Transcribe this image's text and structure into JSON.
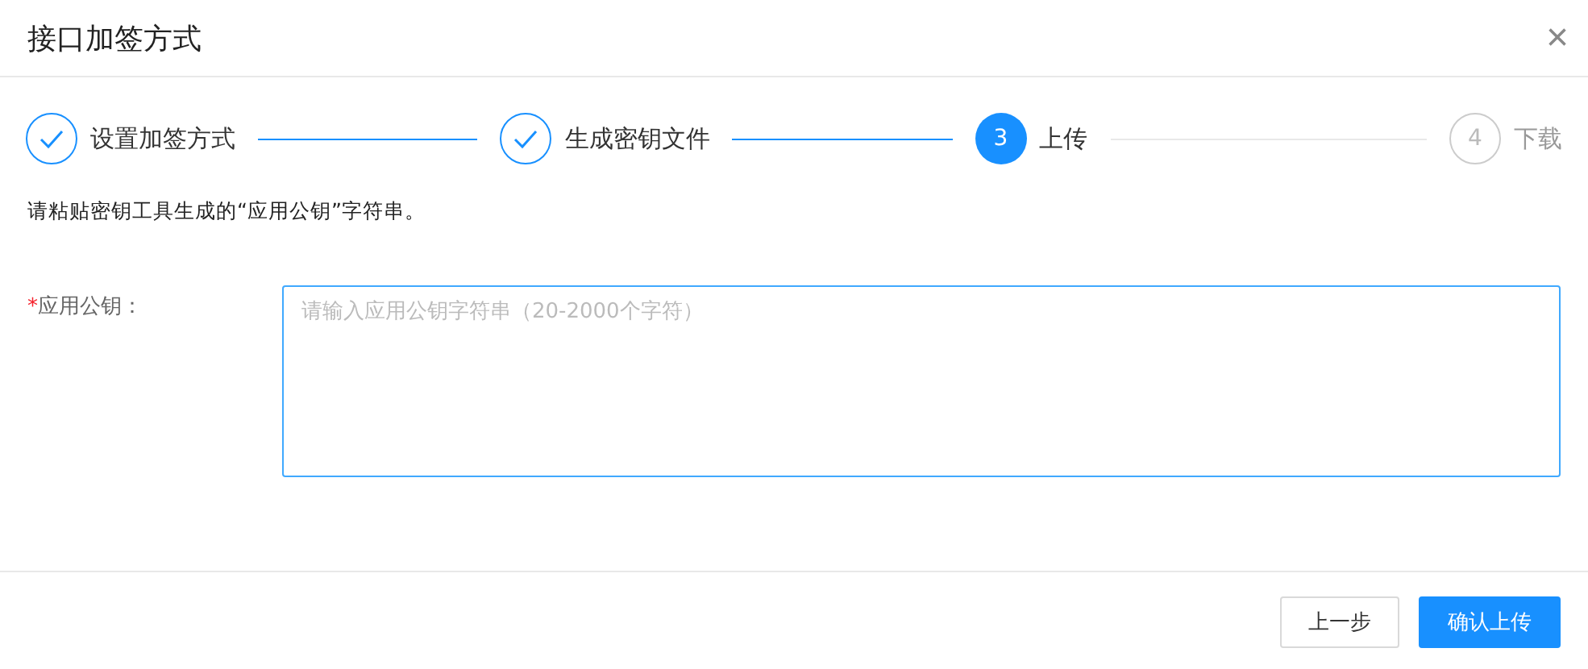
{
  "dialog": {
    "title": "接口加签方式",
    "close": "×"
  },
  "steps": [
    {
      "label": "设置加签方式",
      "done": true,
      "selected": false
    },
    {
      "label": "生成密钥文件",
      "done": true,
      "selected": false
    },
    {
      "number": "3",
      "label": "上传",
      "done": false,
      "selected": true
    },
    {
      "number": "4",
      "label": "下载",
      "done": false,
      "selected": false
    }
  ],
  "instruction": "请粘贴密钥工具生成的“应用公钥”字符串。",
  "field": {
    "required_mark": "*",
    "label": "应用公钥：",
    "placeholder": "请输入应用公钥字符串（20-2000个字符）",
    "focused": true
  },
  "buttons": [
    {
      "label": "上一步",
      "kind": "default"
    },
    {
      "label": "确认上传",
      "kind": "primary"
    }
  ]
}
